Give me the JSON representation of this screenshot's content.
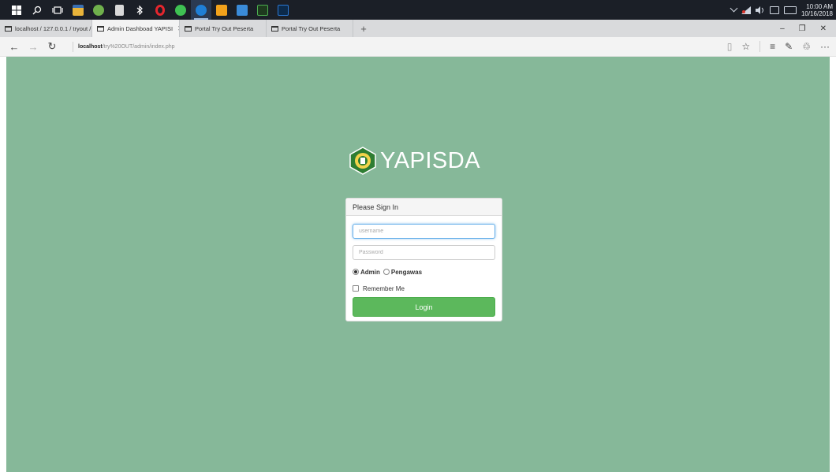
{
  "taskbar": {
    "apps": [
      {
        "icon": "windows-start-icon",
        "color": "#ffffff"
      },
      {
        "icon": "search-icon",
        "color": "#ffffff"
      },
      {
        "icon": "task-view-icon",
        "color": "#ffffff"
      },
      {
        "icon": "file-explorer-icon",
        "color": "#e8b33a"
      },
      {
        "icon": "xampp-icon",
        "color": "#6fb04c"
      },
      {
        "icon": "calculator-icon",
        "color": "#d9d9d9"
      },
      {
        "icon": "bluetooth-icon",
        "color": "#ffffff"
      },
      {
        "icon": "opera-icon",
        "color": "#e5262d"
      },
      {
        "icon": "whatsapp-icon",
        "color": "#3fc152"
      },
      {
        "icon": "edge-icon",
        "color": "#1f7fd6"
      },
      {
        "icon": "media-player-icon",
        "color": "#f2a21b"
      },
      {
        "icon": "photos-icon",
        "color": "#3a8bd8"
      },
      {
        "icon": "dreamweaver-icon",
        "color": "#4caf50"
      },
      {
        "icon": "photoshop-icon",
        "color": "#2b78d4"
      }
    ],
    "clock_time": "10:00 AM",
    "clock_date": "10/16/2018"
  },
  "browser": {
    "tabs": [
      {
        "label": "localhost / 127.0.0.1 / tryout /"
      },
      {
        "label": "Admin Dashboad YAPISI",
        "close": "✕"
      },
      {
        "label": "Portal Try Out Peserta"
      },
      {
        "label": "Portal Try Out Peserta"
      }
    ],
    "new_tab": "+",
    "window_controls": {
      "minimize": "–",
      "restore": "❐",
      "close": "✕"
    },
    "nav": {
      "back": "←",
      "forward": "→",
      "refresh": "↻"
    },
    "url_host": "localhost",
    "url_path": "/try%20OUT/admin/index.php",
    "toolbar_icons": {
      "reading_view": "▯",
      "favorite": "☆",
      "hub": "≡",
      "notes": "✎",
      "share": "♲",
      "more": "···"
    }
  },
  "page": {
    "background_color": "#86b899",
    "brand": "YAPISDA",
    "panel_title": "Please Sign In",
    "username_placeholder": "username",
    "password_placeholder": "Password",
    "role_options": [
      "Admin",
      "Pengawas"
    ],
    "role_selected": "Admin",
    "remember_label": "Remember Me",
    "login_label": "Login",
    "login_color": "#5cb85c"
  }
}
